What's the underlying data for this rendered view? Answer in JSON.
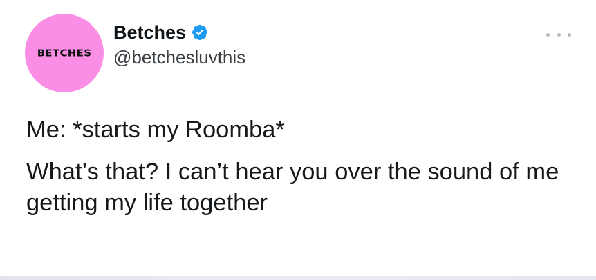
{
  "tweet": {
    "avatar": {
      "logo_text": "BETCHES",
      "background_color": "#f98ee4"
    },
    "author": {
      "display_name": "Betches",
      "handle": "@betchesluvthis",
      "verified_icon": "verified-badge-icon",
      "verified_color": "#1d9bf0"
    },
    "more_icon": "more-options-icon",
    "text": {
      "line1": "Me: *starts my Roomba*",
      "line2": "What’s that? I can’t hear you over the sound of me getting my life together"
    }
  }
}
